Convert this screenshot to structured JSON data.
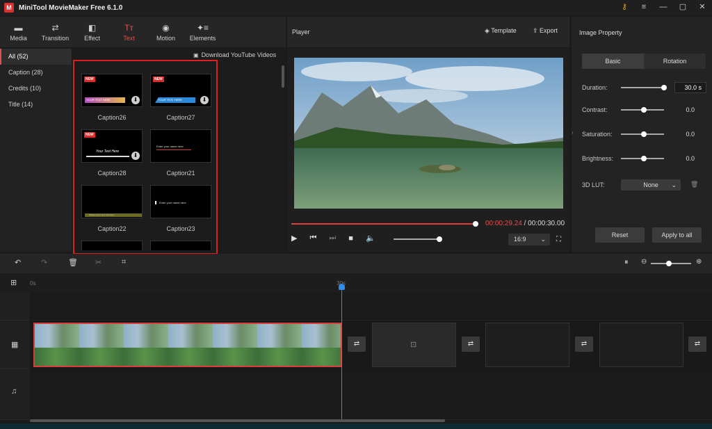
{
  "app": {
    "title": "MiniTool MovieMaker Free 6.1.0",
    "logo_letter": "M"
  },
  "window_controls": {
    "key": "⚷",
    "menu": "≡",
    "minimize": "—",
    "maximize": "▢",
    "close": "✕"
  },
  "toolbar": {
    "items": [
      {
        "label": "Media",
        "icon": "▬"
      },
      {
        "label": "Transition",
        "icon": "⇄"
      },
      {
        "label": "Effect",
        "icon": "◧"
      },
      {
        "label": "Text",
        "icon": "Tт"
      },
      {
        "label": "Motion",
        "icon": "◉"
      },
      {
        "label": "Elements",
        "icon": "✦≡"
      }
    ]
  },
  "library": {
    "categories": [
      {
        "label": "All (52)"
      },
      {
        "label": "Caption (28)"
      },
      {
        "label": "Credits (10)"
      },
      {
        "label": "Title (14)"
      }
    ],
    "download_link": "Download YouTube Videos",
    "thumbs": [
      {
        "label": "Caption26",
        "new": "NEW",
        "text": "YOUR TEXT HERE"
      },
      {
        "label": "Caption27",
        "new": "NEW",
        "text": "YOUR TEXT HERE"
      },
      {
        "label": "Caption28",
        "new": "NEW",
        "text": "Your Text Here"
      },
      {
        "label": "Caption21",
        "text": "Enter your name here"
      },
      {
        "label": "Caption22",
        "text": "Please enter your text here"
      },
      {
        "label": "Caption23",
        "text": "Enter your name here"
      }
    ]
  },
  "player": {
    "title": "Player",
    "template_label": "Template",
    "export_label": "Export",
    "current_time": "00:00:29.24",
    "separator": " / ",
    "total_time": "00:00:30.00",
    "progress": 1.0,
    "volume": 1.0,
    "aspect_ratio": "16:9"
  },
  "property": {
    "title": "Image Property",
    "tabs": [
      {
        "label": "Basic"
      },
      {
        "label": "Rotation"
      }
    ],
    "rows": [
      {
        "label": "Duration:",
        "value": "30.0 s"
      },
      {
        "label": "Contrast:",
        "value": "0.0"
      },
      {
        "label": "Saturation:",
        "value": "0.0"
      },
      {
        "label": "Brightness:",
        "value": "0.0"
      }
    ],
    "lut_label": "3D LUT:",
    "lut_value": "None",
    "reset_label": "Reset",
    "apply_label": "Apply to all"
  },
  "timeline": {
    "ruler_start": "0s",
    "ruler_mark": "30s"
  },
  "colors": {
    "accent": "#e05050",
    "playhead": "#2f8ee8",
    "selection": "#e02020"
  }
}
